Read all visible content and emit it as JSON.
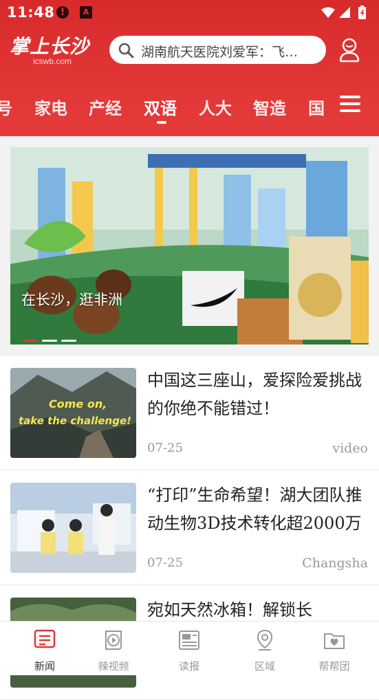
{
  "status_bar": {
    "time": "11:48",
    "alert_glyph": "!",
    "app_glyph": "A"
  },
  "header": {
    "logo_text": "掌上长沙",
    "logo_domain": "icswb.com",
    "search_placeholder": "湖南航天医院刘爱军：飞…",
    "brand_color": "#e23636"
  },
  "tabs": {
    "items": [
      {
        "label": "号"
      },
      {
        "label": "家电"
      },
      {
        "label": "产经"
      },
      {
        "label": "双语",
        "active": true
      },
      {
        "label": "人大"
      },
      {
        "label": "智造"
      },
      {
        "label": "国"
      }
    ]
  },
  "banner": {
    "caption": "在长沙，逛非洲",
    "slide_count": 3,
    "active_slide": 1
  },
  "articles": [
    {
      "title": "中国这三座山，爱探险爱挑战的你绝不能错过！",
      "date": "07-25",
      "tag": "video",
      "thumb_overlay_line1": "Come on,",
      "thumb_overlay_line2": "take the challenge!"
    },
    {
      "title": "“打印”生命希望！湖大团队推动生物3D技术转化超2000万",
      "date": "07-25",
      "tag": "Changsha"
    },
    {
      "title": "宛如天然冰箱！解锁长",
      "date": "",
      "tag": ""
    }
  ],
  "bottom_nav": [
    {
      "label": "新闻",
      "icon": "news-icon",
      "active": true
    },
    {
      "label": "辣视频",
      "icon": "video-icon"
    },
    {
      "label": "读报",
      "icon": "newspaper-icon"
    },
    {
      "label": "区域",
      "icon": "location-icon"
    },
    {
      "label": "帮帮团",
      "icon": "folder-heart-icon"
    }
  ]
}
